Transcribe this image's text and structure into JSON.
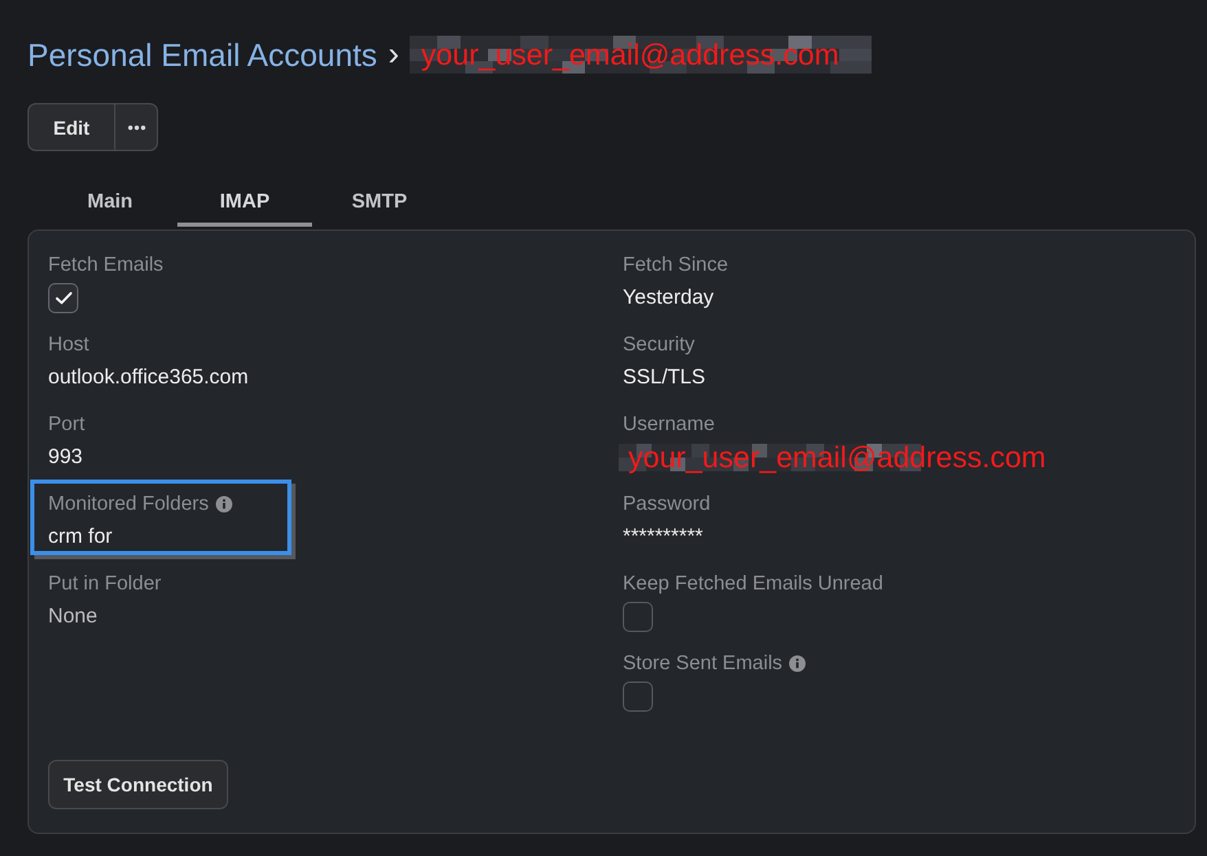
{
  "breadcrumb": {
    "parent": "Personal Email Accounts",
    "separator": "›",
    "current": {
      "kind": "redacted",
      "text": "your_user_email@address.com"
    }
  },
  "toolbar": {
    "edit": "Edit"
  },
  "tabs": [
    {
      "label": "Main",
      "selected": false
    },
    {
      "label": "IMAP",
      "selected": true
    },
    {
      "label": "SMTP",
      "selected": false
    }
  ],
  "form": {
    "columns": [
      {
        "fields": [
          {
            "kind": "checkbox",
            "label": "Fetch Emails",
            "info": false,
            "highlighted": false,
            "checked": true
          },
          {
            "kind": "text",
            "label": "Host",
            "info": false,
            "highlighted": false,
            "value": "outlook.office365.com",
            "muted": false
          },
          {
            "kind": "text",
            "label": "Port",
            "info": false,
            "highlighted": false,
            "value": "993",
            "muted": false
          },
          {
            "kind": "text",
            "label": "Monitored Folders",
            "info": true,
            "highlighted": true,
            "value": "crm for",
            "muted": false
          },
          {
            "kind": "text",
            "label": "Put in Folder",
            "info": false,
            "highlighted": false,
            "value": "None",
            "muted": true
          }
        ]
      },
      {
        "fields": [
          {
            "kind": "text",
            "label": "Fetch Since",
            "info": false,
            "highlighted": false,
            "value": "Yesterday",
            "muted": false
          },
          {
            "kind": "text",
            "label": "Security",
            "info": false,
            "highlighted": false,
            "value": "SSL/TLS",
            "muted": false
          },
          {
            "kind": "redacted",
            "label": "Username",
            "info": false,
            "highlighted": false,
            "value": "your_user_email@address.com"
          },
          {
            "kind": "text",
            "label": "Password",
            "info": false,
            "highlighted": false,
            "value": "**********",
            "muted": false
          },
          {
            "kind": "checkbox",
            "label": "Keep Fetched Emails Unread",
            "info": false,
            "highlighted": false,
            "checked": false
          },
          {
            "kind": "checkbox",
            "label": "Store Sent Emails",
            "info": true,
            "highlighted": false,
            "checked": false
          }
        ]
      }
    ],
    "test_button": "Test Connection"
  }
}
